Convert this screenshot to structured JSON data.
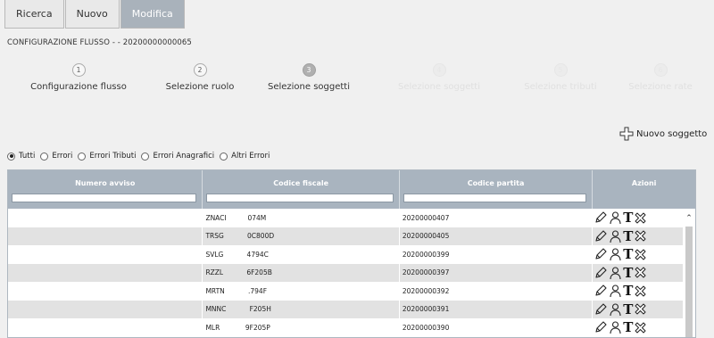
{
  "tabs": [
    "Ricerca",
    "Nuovo",
    "Modifica"
  ],
  "flow_title": "CONFIGURAZIONE FLUSSO - - 20200000000065",
  "steps": [
    {
      "num": "1",
      "label": "Configurazione flusso"
    },
    {
      "num": "2",
      "label": "Selezione ruolo"
    },
    {
      "num": "3",
      "label": "Selezione soggetti"
    },
    {
      "num": "4",
      "label": "Selezione soggetti"
    },
    {
      "num": "5",
      "label": "Selezione tributi"
    },
    {
      "num": "6",
      "label": "Selezione rate"
    }
  ],
  "new_subject_label": "Nuovo soggetto",
  "filters": [
    "Tutti",
    "Errori",
    "Errori Tributi",
    "Errori Anagrafici",
    "Altri Errori"
  ],
  "selected_filter": "Tutti",
  "table": {
    "headers": [
      "Numero avviso",
      "Codice fiscale",
      "Codice partita",
      "Azioni"
    ],
    "rows": [
      {
        "avviso": "",
        "cf": "ZNACI          074M",
        "partita": "20200000407"
      },
      {
        "avviso": "",
        "cf": "TRSG           0C800D",
        "partita": "20200000405"
      },
      {
        "avviso": "",
        "cf": "SVLG           4794C",
        "partita": "20200000399"
      },
      {
        "avviso": "",
        "cf": "RZZL           6F205B",
        "partita": "20200000397"
      },
      {
        "avviso": "",
        "cf": "MRTN           .794F",
        "partita": "20200000392"
      },
      {
        "avviso": "",
        "cf": "MNNC           F205H",
        "partita": "20200000391"
      },
      {
        "avviso": "",
        "cf": "MLR            9F205P",
        "partita": "20200000390"
      }
    ],
    "action_icons": [
      "pencil-icon",
      "user-icon",
      "text-icon",
      "delete-icon"
    ],
    "action_text_glyph": "T"
  },
  "colors": {
    "active_tab": "#a9b2bb",
    "grid_header": "#a9b4bf",
    "row_alt": "#e2e2e2"
  }
}
